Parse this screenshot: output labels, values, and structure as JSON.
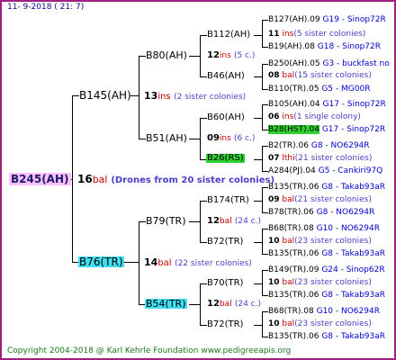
{
  "header": {
    "date": "11-  9-2018 (  21:  7)"
  },
  "footer": {
    "copyright": "Copyright 2004-2018 @ Karl Kehrle Foundation    www.pedigreeapis.org"
  },
  "root": {
    "name": "B245(AH)",
    "count": "16",
    "race": "bal",
    "note": "(Drones from 20 sister colonies)"
  },
  "gen1": {
    "father": {
      "name": "B145(AH)",
      "count": "13",
      "race": "ins",
      "note": "(2 sister colonies)"
    },
    "mother": {
      "name": "B76(TR)",
      "count": "14",
      "race": "bal",
      "note": "(22 sister colonies)"
    }
  },
  "gen2": [
    {
      "name": "B80(AH)",
      "count": "",
      "race": "",
      "note": ""
    },
    {
      "name": "B51(AH)",
      "count": "",
      "race": "",
      "note": ""
    },
    {
      "name": "B79(TR)",
      "count": "",
      "race": "",
      "note": ""
    },
    {
      "name": "B54(TR)",
      "count": "",
      "race": "",
      "note": ""
    }
  ],
  "gen3": [
    {
      "name": "B112(AH)",
      "count": "11",
      "race": "ins",
      "note": "(5 sister colonies)"
    },
    {
      "name": "B46(AH)",
      "count": "08",
      "race": "bal",
      "note": "(15 sister colonies)"
    },
    {
      "name": "B60(AH)",
      "count": "06",
      "race": "ins",
      "note": "(1 single colony)"
    },
    {
      "name": "B26(RS)",
      "count": "07",
      "race": "lthi",
      "note": "(21 sister colonies)"
    },
    {
      "name": "B174(TR)",
      "count": "09",
      "race": "bal",
      "note": "(21 sister colonies)"
    },
    {
      "name": "B72(TR)",
      "count": "10",
      "race": "bal",
      "note": "(23 sister colonies)"
    },
    {
      "name": "B70(TR)",
      "count": "10",
      "race": "bal",
      "note": "(23 sister colonies)"
    },
    {
      "name": "B72(TR)",
      "count": "10",
      "race": "bal",
      "note": "(23 sister colonies)"
    }
  ],
  "gen2_labels": [
    {
      "count": "12",
      "race": "ins",
      "note": "(5 c.)"
    },
    {
      "count": "09",
      "race": "ins",
      "note": "(6 c.)"
    },
    {
      "count": "12",
      "race": "bal",
      "note": "(24 c.)"
    },
    {
      "count": "12",
      "race": "bal",
      "note": "(24 c.)"
    }
  ],
  "gen4": [
    {
      "name": "B127(AH).09",
      "source": "G19 - Sinop72R"
    },
    {
      "name": "B19(AH).08",
      "source": "G18 - Sinop72R"
    },
    {
      "name": "B250(AH).05",
      "source": "G3 - buckfast no"
    },
    {
      "name": "B110(TR).05",
      "source": "G5 - MG00R"
    },
    {
      "name": "B105(AH).04",
      "source": "G17 - Sinop72R"
    },
    {
      "name": "B28(HST).04",
      "source": "G17 - Sinop72R"
    },
    {
      "name": "B2(TR).06",
      "source": "G8 - NO6294R"
    },
    {
      "name": "A284(PJ).04",
      "source": "G5 - Cankiri97Q"
    },
    {
      "name": "B135(TR).06",
      "source": "G8 - Takab93aR"
    },
    {
      "name": "B78(TR).06",
      "source": "G8 - NO6294R"
    },
    {
      "name": "B68(TR).08",
      "source": "G10 - NO6294R"
    },
    {
      "name": "B135(TR).06",
      "source": "G8 - Takab93aR"
    },
    {
      "name": "B149(TR).09",
      "source": "G24 - Sinop62R"
    },
    {
      "name": "B135(TR).06",
      "source": "G8 - Takab93aR"
    },
    {
      "name": "B68(TR).08",
      "source": "G10 - NO6294R"
    },
    {
      "name": "B135(TR).06",
      "source": "G8 - Takab93aR"
    }
  ],
  "colors": {
    "root_box": "#ffc0ff",
    "mother_box": "#40e0f0",
    "b54_box": "#40e0f0",
    "green_box": "#30d030",
    "frame": "#a02080",
    "source": "#0000cc",
    "race": "#c00000",
    "note": "#4a3ec8"
  }
}
